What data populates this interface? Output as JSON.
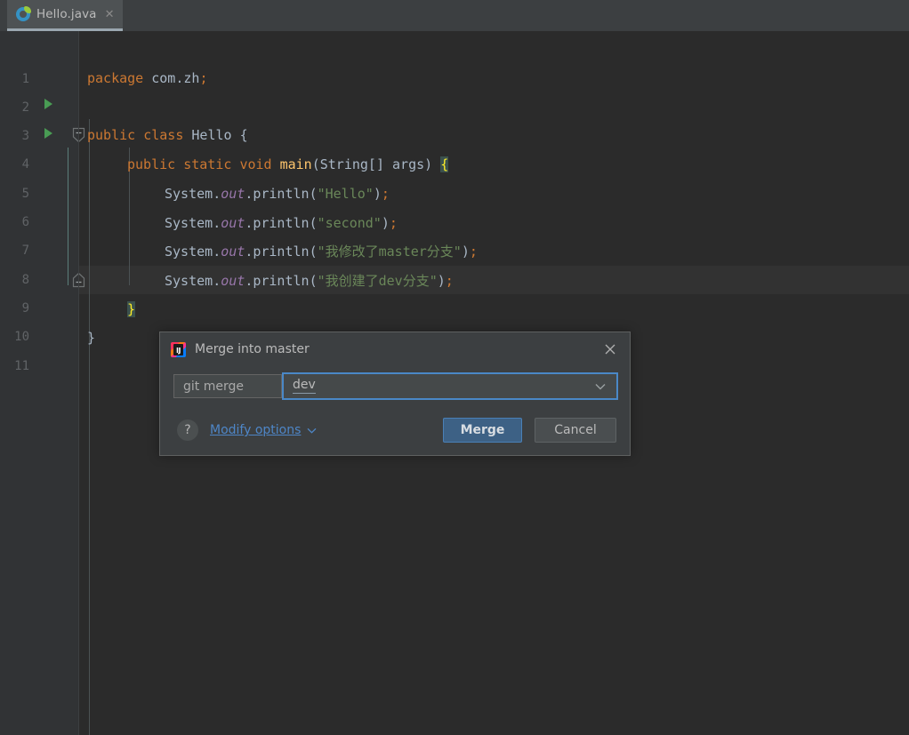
{
  "window": {
    "tab": {
      "label": "Hello.java",
      "icon": "java-class-icon",
      "close_label": "✕"
    }
  },
  "editor": {
    "language": "java",
    "current_line": 9,
    "lines": [
      {
        "number": "1",
        "text": "package com.zh;"
      },
      {
        "number": "2",
        "text": ""
      },
      {
        "number": "3",
        "text": "public class Hello {"
      },
      {
        "number": "4",
        "text": "    public static void main(String[] args) {"
      },
      {
        "number": "5",
        "text": "        System.out.println(\"Hello\");"
      },
      {
        "number": "6",
        "text": "        System.out.println(\"second\");"
      },
      {
        "number": "7",
        "text": "        System.out.println(\"我修改了master分支\");"
      },
      {
        "number": "8",
        "text": "        System.out.println(\"我创建了dev分支\");"
      },
      {
        "number": "9",
        "text": "    }"
      },
      {
        "number": "10",
        "text": "}"
      },
      {
        "number": "11",
        "text": ""
      }
    ],
    "tokens": {
      "kw_package": "package",
      "pkg_name": "com.zh",
      "kw_public": "public",
      "kw_class": "class",
      "class_name": "Hello",
      "kw_static": "static",
      "kw_void": "void",
      "method_main": "main",
      "type_string_array": "String[]",
      "param_args": "args",
      "system": "System",
      "out": "out",
      "println": "println",
      "semicolon": ";",
      "open_paren": "(",
      "close_paren": ")",
      "dot": ".",
      "open_brace": "{",
      "close_brace": "}",
      "str_hello": "\"Hello\"",
      "str_second": "\"second\"",
      "str_master": "\"我修改了master分支\"",
      "str_dev": "\"我创建了dev分支\""
    },
    "gutter": {
      "run_marker_lines": [
        3,
        4
      ],
      "fold_marker_lines": [
        4,
        9
      ]
    },
    "colors": {
      "background": "#2b2b2b",
      "gutter": "#313335",
      "current_line": "#323232",
      "keyword": "#cc7832",
      "string": "#6a8759",
      "method": "#ffc66d",
      "field": "#9876aa",
      "identifier": "#a9b7c6",
      "line_number": "#606366",
      "run_arrow": "#499c54",
      "brace_match_bg": "#3b514d",
      "brace_match_fg": "#ffef28",
      "change_marker": "#5a5440"
    }
  },
  "dialog": {
    "title": "Merge into master",
    "app_icon": "intellij-idea-icon",
    "app_icon_text": "IJ",
    "close_icon": "close-icon",
    "command_label": "git merge",
    "branch_value": "dev",
    "branch_dropdown_icon": "chevron-down-icon",
    "help_label": "?",
    "modify_options": {
      "mnemonic": "M",
      "rest": "odify options",
      "caret_icon": "chevron-down-icon"
    },
    "buttons": {
      "primary": "Merge",
      "secondary": "Cancel"
    },
    "colors": {
      "background": "#3c3f41",
      "focus_border": "#4a88c7",
      "primary_button": "#3d6185",
      "link": "#4e86c7"
    }
  }
}
